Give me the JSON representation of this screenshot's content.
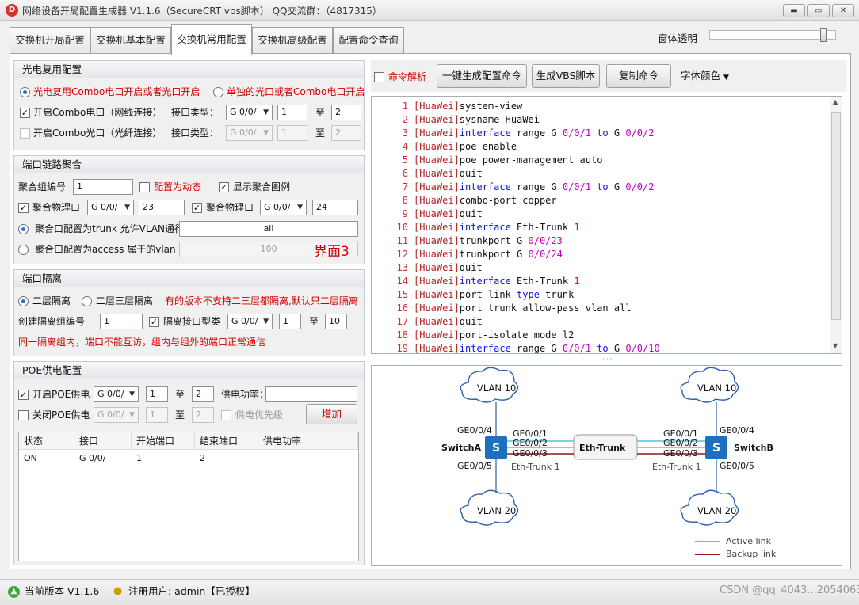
{
  "window": {
    "title": "网络设备开局配置生成器  V1.1.6（SecureCRT vbs脚本） QQ交流群：（4817315）",
    "icon": "D",
    "controls": [
      "minimize-icon",
      "maximize-icon",
      "close-icon"
    ]
  },
  "tabs": [
    {
      "label": "交换机开局配置"
    },
    {
      "label": "交换机基本配置"
    },
    {
      "label": "交换机常用配置",
      "active": true
    },
    {
      "label": "交换机高级配置"
    },
    {
      "label": "配置命令查询"
    }
  ],
  "transparency": {
    "label": "窗体透明",
    "level": 0.9
  },
  "optical": {
    "title": "光电复用配置",
    "radio1": "光电复用Combo电口开启或者光口开启",
    "radio2": "单独的光口或者Combo电口开启",
    "row1_cb": "开启Combo电口（网线连接）",
    "row1_type": "接口类型：",
    "row1_sel": "G 0/0/",
    "row1_from": "1",
    "row1_to_label": "至",
    "row1_to": "2",
    "row2_cb": "开启Combo光口（光纤连接）",
    "row2_type": "接口类型：",
    "row2_sel": "G 0/0/",
    "row2_from": "1",
    "row2_to_label": "至",
    "row2_to": "2"
  },
  "aggregation": {
    "title": "端口链路聚合",
    "group_label": "聚合组编号",
    "group_value": "1",
    "dynamic_label": "配置为动态",
    "show_label": "显示聚合图例",
    "phys1_label": "聚合物理口",
    "phys1_sel": "G 0/0/",
    "phys1_val": "23",
    "phys2_label": "聚合物理口",
    "phys2_sel": "G 0/0/",
    "phys2_val": "24",
    "trunk_label": "聚合口配置为trunk 允许VLAN通行",
    "trunk_val": "all",
    "access_label": "聚合口配置为access 属于的vlan",
    "access_val": "100",
    "watermark": "界面3"
  },
  "isolation": {
    "title": "端口隔离",
    "radio1": "二层隔离",
    "radio2": "二层三层隔离",
    "note": "有的版本不支持二三层都隔离,默认只二层隔离",
    "group_label": "创建隔离组编号",
    "group_val": "1",
    "iface_label": "隔离接口型类",
    "iface_sel": "G 0/0/",
    "from": "1",
    "to_label": "至",
    "to": "10",
    "warning": "同一隔离组内，端口不能互访，组内与组外的端口正常通信"
  },
  "poe": {
    "title": "POE供电配置",
    "on_label": "开启POE供电",
    "on_sel": "G 0/0/",
    "on_from": "1",
    "on_to_label": "至",
    "on_to": "2",
    "power_label": "供电功率：",
    "power_val": "",
    "off_label": "关闭POE供电",
    "off_sel": "G 0/0/",
    "off_from": "1",
    "off_to_label": "至",
    "off_to": "2",
    "priority_label": "供电优先级",
    "add_button": "增加",
    "table": {
      "headers": [
        "状态",
        "接口",
        "开始端口",
        "结束端口",
        "供电功率"
      ],
      "rows": [
        [
          "ON",
          "G 0/0/",
          "1",
          "2",
          ""
        ]
      ]
    }
  },
  "toolbar": {
    "parse_label": "命令解析",
    "gen_button": "一键生成配置命令",
    "vbs_button": "生成VBS脚本",
    "copy_button": "复制命令",
    "font_color": "字体颜色"
  },
  "code_lines": [
    {
      "n": "1",
      "segs": [
        [
          "[HuaWei]",
          "b"
        ],
        [
          "system-view",
          "k"
        ]
      ]
    },
    {
      "n": "2",
      "segs": [
        [
          "[HuaWei]",
          "b"
        ],
        [
          "sysname HuaWei",
          "k"
        ]
      ]
    },
    {
      "n": "3",
      "segs": [
        [
          "[HuaWei]",
          "b"
        ],
        [
          "interface",
          "bl"
        ],
        [
          " range G ",
          "k"
        ],
        [
          "0/0/1",
          "m"
        ],
        [
          " to",
          "bl"
        ],
        [
          " G ",
          "k"
        ],
        [
          "0/0/2",
          "m"
        ]
      ]
    },
    {
      "n": "4",
      "segs": [
        [
          "[HuaWei]",
          "b"
        ],
        [
          "poe enable",
          "k"
        ]
      ]
    },
    {
      "n": "5",
      "segs": [
        [
          "[HuaWei]",
          "b"
        ],
        [
          "poe power-management auto",
          "k"
        ]
      ]
    },
    {
      "n": "6",
      "segs": [
        [
          "[HuaWei]",
          "b"
        ],
        [
          "quit",
          "k"
        ]
      ]
    },
    {
      "n": "7",
      "segs": [
        [
          "[HuaWei]",
          "b"
        ],
        [
          "interface",
          "bl"
        ],
        [
          " range G ",
          "k"
        ],
        [
          "0/0/1",
          "m"
        ],
        [
          " to",
          "bl"
        ],
        [
          " G ",
          "k"
        ],
        [
          "0/0/2",
          "m"
        ]
      ]
    },
    {
      "n": "8",
      "segs": [
        [
          "[HuaWei]",
          "b"
        ],
        [
          "combo-port copper",
          "k"
        ]
      ]
    },
    {
      "n": "9",
      "segs": [
        [
          "[HuaWei]",
          "b"
        ],
        [
          "quit",
          "k"
        ]
      ]
    },
    {
      "n": "10",
      "segs": [
        [
          "[HuaWei]",
          "b"
        ],
        [
          "interface",
          "bl"
        ],
        [
          " Eth-Trunk ",
          "k"
        ],
        [
          "1",
          "m"
        ]
      ]
    },
    {
      "n": "11",
      "segs": [
        [
          "[HuaWei]",
          "b"
        ],
        [
          "trunkport G ",
          "k"
        ],
        [
          "0/0/23",
          "m"
        ]
      ]
    },
    {
      "n": "12",
      "segs": [
        [
          "[HuaWei]",
          "b"
        ],
        [
          "trunkport G ",
          "k"
        ],
        [
          "0/0/24",
          "m"
        ]
      ]
    },
    {
      "n": "13",
      "segs": [
        [
          "[HuaWei]",
          "b"
        ],
        [
          "quit",
          "k"
        ]
      ]
    },
    {
      "n": "14",
      "segs": [
        [
          "[HuaWei]",
          "b"
        ],
        [
          "interface",
          "bl"
        ],
        [
          " Eth-Trunk ",
          "k"
        ],
        [
          "1",
          "m"
        ]
      ]
    },
    {
      "n": "15",
      "segs": [
        [
          "[HuaWei]",
          "b"
        ],
        [
          "port link-",
          "k"
        ],
        [
          "type",
          "bl"
        ],
        [
          " trunk",
          "k"
        ]
      ]
    },
    {
      "n": "16",
      "segs": [
        [
          "[HuaWei]",
          "b"
        ],
        [
          "port trunk allow-pass vlan all",
          "k"
        ]
      ]
    },
    {
      "n": "17",
      "segs": [
        [
          "[HuaWei]",
          "b"
        ],
        [
          "quit",
          "k"
        ]
      ]
    },
    {
      "n": "18",
      "segs": [
        [
          "[HuaWei]",
          "b"
        ],
        [
          "port-isolate mode l2",
          "k"
        ]
      ]
    },
    {
      "n": "19",
      "segs": [
        [
          "[HuaWei]",
          "b"
        ],
        [
          "interface",
          "bl"
        ],
        [
          " range G ",
          "k"
        ],
        [
          "0/0/1",
          "m"
        ],
        [
          " to",
          "bl"
        ],
        [
          " G ",
          "k"
        ],
        [
          "0/0/10",
          "m"
        ]
      ]
    }
  ],
  "diagram": {
    "vlan_tl": "VLAN 10",
    "vlan_tr": "VLAN 10",
    "vlan_bl": "VLAN 20",
    "vlan_br": "VLAN 20",
    "switch_a": "SwitchA",
    "switch_b": "SwitchB",
    "switch_glyph": "S",
    "trunk": "Eth-Trunk",
    "a_ge04": "GE0/0/4",
    "a_ge05": "GE0/0/5",
    "a_ge01": "GE0/0/1",
    "a_ge02": "GE0/0/2",
    "a_ge03": "GE0/0/3",
    "b_ge01": "GE0/0/1",
    "b_ge02": "GE0/0/2",
    "b_ge03": "GE0/0/3",
    "b_ge04": "GE0/0/4",
    "b_ge05": "GE0/0/5",
    "a_trunk_label": "Eth-Trunk 1",
    "b_trunk_label": "Eth-Trunk 1",
    "legend_active": "Active link",
    "legend_backup": "Backup link",
    "colors": {
      "active": "#4fc6de",
      "backup": "#8b1a1a",
      "switch": "#1e6fbf"
    }
  },
  "status": {
    "version": "当前版本 V1.1.6",
    "user": "注册用户: admin【已授权】",
    "watermark": "CSDN @qq_4043...2054063"
  },
  "colors": {
    "red_text": "#d00000",
    "keyword_blue": "#1010e8",
    "number_magenta": "#c000c0",
    "bracket_red": "#b22222"
  }
}
